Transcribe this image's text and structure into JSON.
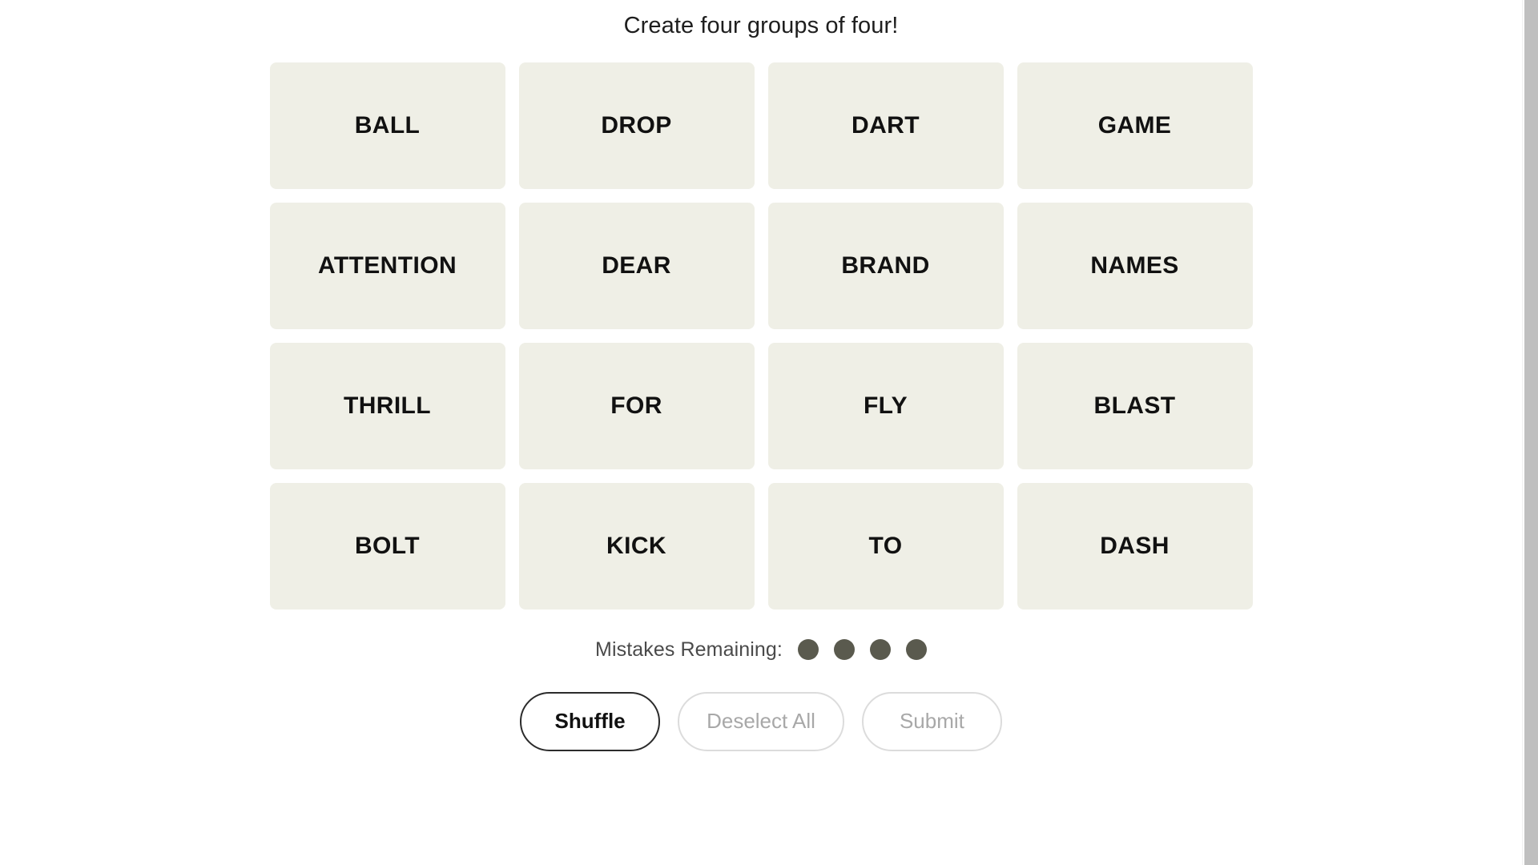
{
  "app": {
    "title": "Create four groups of four!"
  },
  "board": {
    "rows": [
      {
        "tiles": [
          {
            "label": "BALL"
          },
          {
            "label": "DROP"
          },
          {
            "label": "DART"
          },
          {
            "label": "GAME"
          }
        ]
      },
      {
        "tiles": [
          {
            "label": "ATTENTION"
          },
          {
            "label": "DEAR"
          },
          {
            "label": "BRAND"
          },
          {
            "label": "NAMES"
          }
        ]
      },
      {
        "tiles": [
          {
            "label": "THRILL"
          },
          {
            "label": "FOR"
          },
          {
            "label": "FLY"
          },
          {
            "label": "BLAST"
          }
        ]
      },
      {
        "tiles": [
          {
            "label": "BOLT"
          },
          {
            "label": "KICK"
          },
          {
            "label": "TO"
          },
          {
            "label": "DASH"
          }
        ]
      }
    ]
  },
  "mistakes": {
    "label": "Mistakes Remaining:",
    "remaining": 4,
    "total": 4,
    "dot_color": "#5A5A4E"
  },
  "actions": {
    "shuffle_label": "Shuffle",
    "deselect_label": "Deselect All",
    "submit_label": "Submit",
    "shuffle_enabled": true,
    "deselect_enabled": false,
    "submit_enabled": false
  },
  "theme": {
    "tile_bg": "#EFEFE6",
    "tile_text": "#111111",
    "page_bg": "#FFFFFF",
    "title_color": "#1E1E1E",
    "muted_text": "#A8A8A8",
    "scrollbar_thumb": "#BFBFBF"
  }
}
